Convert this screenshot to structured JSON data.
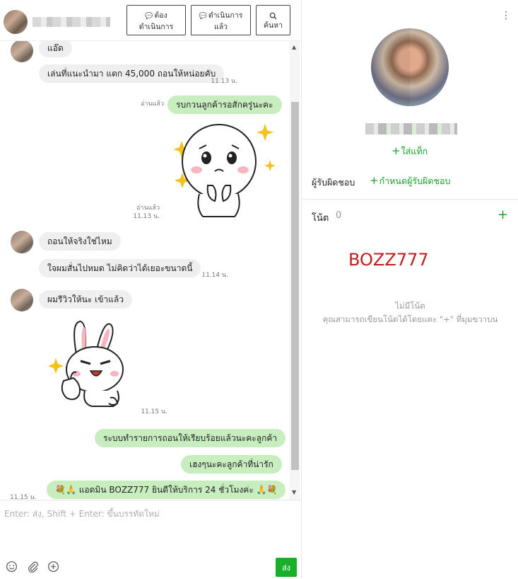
{
  "header": {
    "btn_todo": {
      "icon": "speech-bubble-icon",
      "line1": "ต้อง",
      "line2": "ดำเนินการ"
    },
    "btn_done": {
      "icon": "speech-bubble-check-icon",
      "line1": "ดำเนินการ",
      "line2": "แล้ว"
    },
    "btn_search": {
      "icon": "search-icon",
      "line1": "🔍︎",
      "line2": "ค้นหา"
    }
  },
  "messages": {
    "m1": "แอ๊ด",
    "m2": "เล่นที่แนะนำมา แตก 45,000 ถอนให้หน่อยคับ",
    "m2_time": "11.13 น.",
    "m3": "รบกวนลูกค้ารอสักครู่นะคะ",
    "m3_read": "อ่านแล้ว",
    "m4_read": "อ่านแล้ว",
    "m4_time": "11.13 น.",
    "m5": "ถอนให้จริงใช่ไหม",
    "m6": "ใจผมสั่นไปหมด ไม่คิดว่าได้เยอะขนาดนี้",
    "m6_time": "11.14 น.",
    "m7": "ผมรีวิวให้นะ เข้าแล้ว",
    "m8_time": "11.15 น.",
    "m9": "ระบบทำรายการถอนให้เรียบร้อยแล้วนะคะลูกค้า",
    "m10": "เฮงๆนะคะลูกค้าที่น่ารัก",
    "m11": "💐🙏 แอดมิน BOZZ777 ยินดีให้บริการ 24 ชั่วโมงค่ะ 🙏💐",
    "m11_time": "11.15 น."
  },
  "composer": {
    "placeholder": "Enter: ส่ง, Shift + Enter: ขึ้นบรรทัดใหม่",
    "send_label": "ส่ง",
    "icons": [
      "emoji-icon",
      "attach-icon",
      "plus-circle-icon"
    ]
  },
  "profile": {
    "add_tag": "ใส่แท็ก",
    "owner_label": "ผู้รับผิดชอบ",
    "assign_owner": "กำหนดผู้รับผิดชอบ",
    "notes_title": "โน้ต",
    "notes_count": "0",
    "note_highlight": "BOZZ777",
    "empty_title": "ไม่มีโน้ต",
    "empty_desc": "คุณสามารถเขียนโน้ตได้โดยแตะ \"+\" ที่มุมขวาบน"
  },
  "colors": {
    "accent": "#19a12a",
    "outgoing_bubble": "#c8eec0",
    "incoming_bubble": "#efefef",
    "note_red": "#c11d1d"
  }
}
